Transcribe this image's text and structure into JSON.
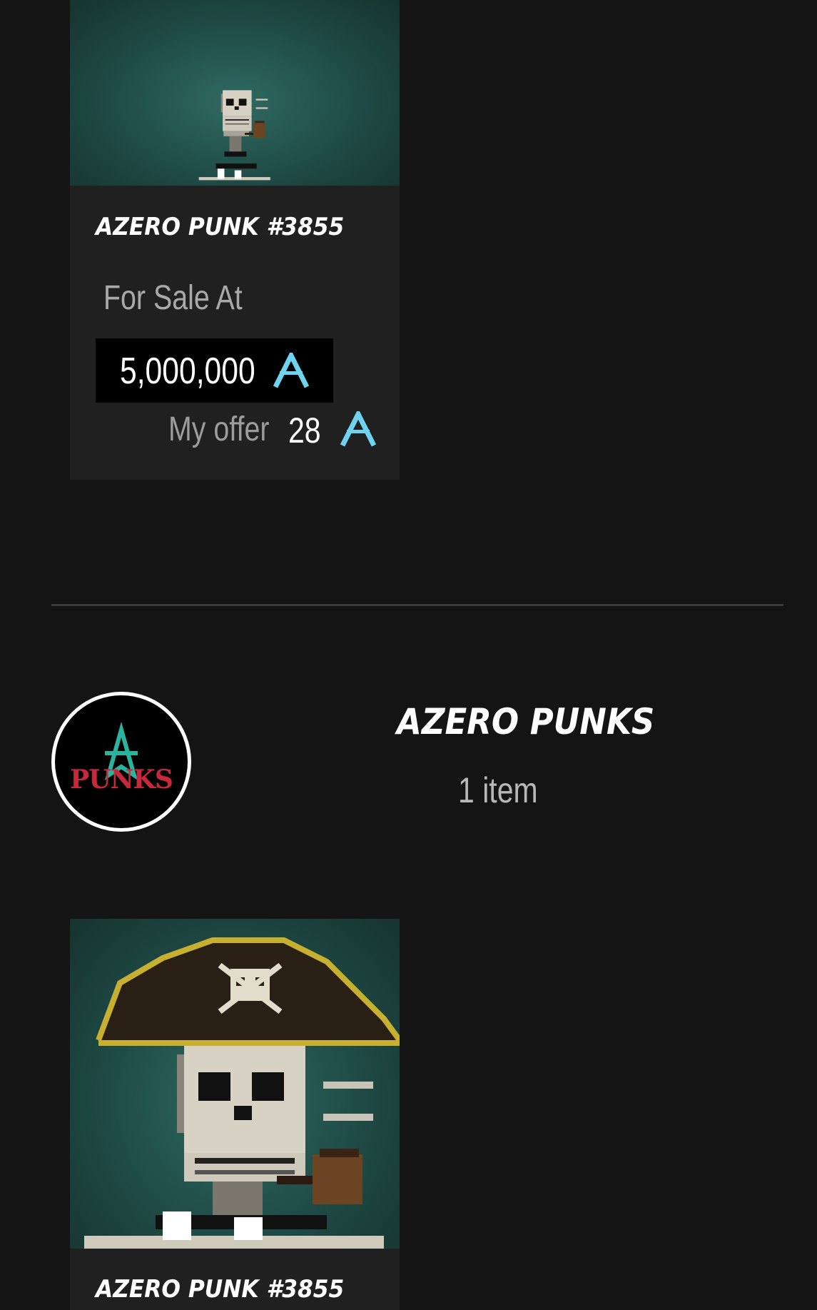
{
  "listing_card": {
    "title": "AZERO PUNK #3855",
    "sale_label": "For Sale At",
    "price": "5,000,000",
    "offer_label": "My offer",
    "offer_value": "28",
    "currency_icon": "azero-icon"
  },
  "collection": {
    "name": "AZERO PUNKS",
    "item_count": "1 item",
    "avatar_text": "PUNKS"
  },
  "collection_card": {
    "title": "AZERO PUNK #3855"
  },
  "colors": {
    "background": "#141414",
    "card": "#202020",
    "accent_azero": "#6fd3f0"
  }
}
